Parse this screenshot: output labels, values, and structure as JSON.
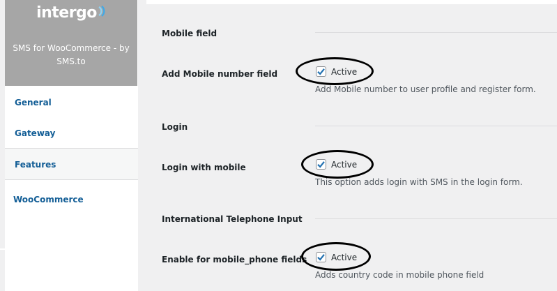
{
  "brand": {
    "logo_text": "intergo",
    "title": "SMS for WooCommerce - by SMS.to"
  },
  "sidebar": {
    "items": [
      {
        "label": "General"
      },
      {
        "label": "Gateway"
      },
      {
        "label": "Features",
        "active": true
      },
      {
        "label": "WooCommerce"
      }
    ]
  },
  "sections": [
    {
      "title": "Mobile field",
      "row": {
        "label": "Add Mobile number field",
        "checkbox_label": "Active",
        "checked": true,
        "description": "Add Mobile number to user profile and register form."
      }
    },
    {
      "title": "Login",
      "row": {
        "label": "Login with mobile",
        "checkbox_label": "Active",
        "checked": true,
        "description": "This option adds login with SMS in the login form."
      }
    },
    {
      "title": "International Telephone Input",
      "row": {
        "label": "Enable for mobile_phone fields",
        "checkbox_label": "Active",
        "checked": true,
        "description": "Adds country code in mobile phone field"
      }
    }
  ],
  "icons": {
    "logo_mark": "intergo-signal-icon",
    "checkmark": "checkmark-icon"
  },
  "colors": {
    "sidebar_link": "#135e96",
    "checkbox_check": "#2271b1",
    "brand_bg": "#a6a6a6",
    "annotation": "#000000"
  }
}
